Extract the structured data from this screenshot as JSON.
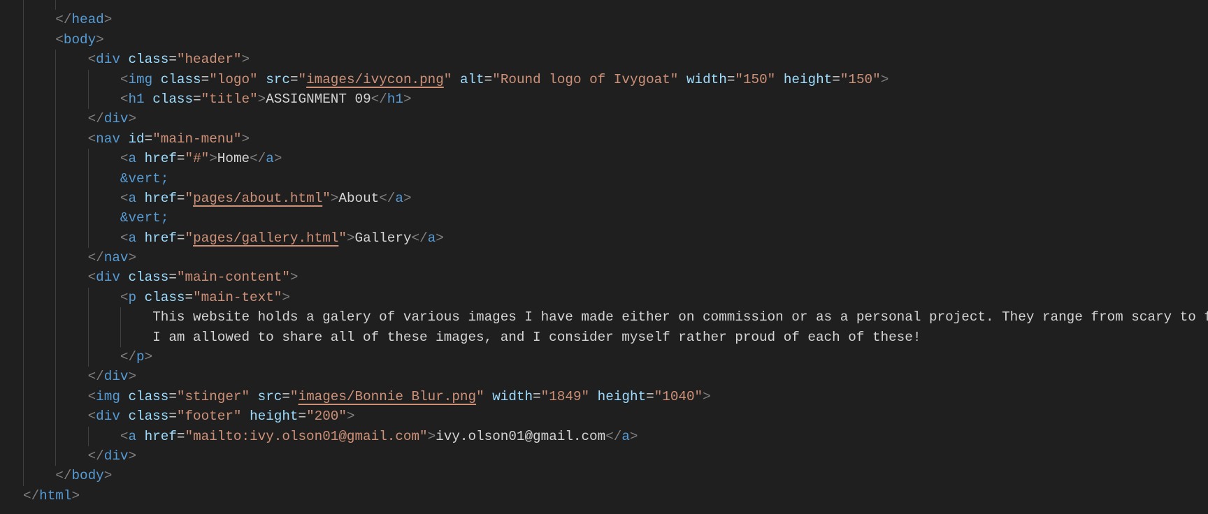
{
  "editor": {
    "colors": {
      "background": "#1f1f1f",
      "punctuation": "#808080",
      "tag": "#569cd6",
      "attribute": "#9cdcfe",
      "string": "#ce9178",
      "text": "#d4d4d4",
      "entity": "#569cd6"
    },
    "lines": [
      {
        "indent": 2,
        "tokens": []
      },
      {
        "indent": 1,
        "tokens": [
          [
            "p",
            "</"
          ],
          [
            "t",
            "head"
          ],
          [
            "p",
            ">"
          ]
        ]
      },
      {
        "indent": 1,
        "tokens": [
          [
            "p",
            "<"
          ],
          [
            "t",
            "body"
          ],
          [
            "p",
            ">"
          ]
        ]
      },
      {
        "indent": 2,
        "tokens": [
          [
            "p",
            "<"
          ],
          [
            "t",
            "div"
          ],
          [
            "x",
            " "
          ],
          [
            "a",
            "class"
          ],
          [
            "x",
            "="
          ],
          [
            "s",
            "\"header\""
          ],
          [
            "p",
            ">"
          ]
        ]
      },
      {
        "indent": 3,
        "tokens": [
          [
            "p",
            "<"
          ],
          [
            "t",
            "img"
          ],
          [
            "x",
            " "
          ],
          [
            "a",
            "class"
          ],
          [
            "x",
            "="
          ],
          [
            "s",
            "\"logo\""
          ],
          [
            "x",
            " "
          ],
          [
            "a",
            "src"
          ],
          [
            "x",
            "="
          ],
          [
            "s",
            "\""
          ],
          [
            "l",
            "images/ivycon.png"
          ],
          [
            "s",
            "\""
          ],
          [
            "x",
            " "
          ],
          [
            "a",
            "alt"
          ],
          [
            "x",
            "="
          ],
          [
            "s",
            "\"Round logo of Ivygoat\""
          ],
          [
            "x",
            " "
          ],
          [
            "a",
            "width"
          ],
          [
            "x",
            "="
          ],
          [
            "s",
            "\"150\""
          ],
          [
            "x",
            " "
          ],
          [
            "a",
            "height"
          ],
          [
            "x",
            "="
          ],
          [
            "s",
            "\"150\""
          ],
          [
            "p",
            ">"
          ]
        ]
      },
      {
        "indent": 3,
        "tokens": [
          [
            "p",
            "<"
          ],
          [
            "t",
            "h1"
          ],
          [
            "x",
            " "
          ],
          [
            "a",
            "class"
          ],
          [
            "x",
            "="
          ],
          [
            "s",
            "\"title\""
          ],
          [
            "p",
            ">"
          ],
          [
            "x",
            "ASSIGNMENT 09"
          ],
          [
            "p",
            "</"
          ],
          [
            "t",
            "h1"
          ],
          [
            "p",
            ">"
          ]
        ]
      },
      {
        "indent": 2,
        "tokens": [
          [
            "p",
            "</"
          ],
          [
            "t",
            "div"
          ],
          [
            "p",
            ">"
          ]
        ]
      },
      {
        "indent": 2,
        "tokens": [
          [
            "p",
            "<"
          ],
          [
            "t",
            "nav"
          ],
          [
            "x",
            " "
          ],
          [
            "a",
            "id"
          ],
          [
            "x",
            "="
          ],
          [
            "s",
            "\"main-menu\""
          ],
          [
            "p",
            ">"
          ]
        ]
      },
      {
        "indent": 3,
        "tokens": [
          [
            "p",
            "<"
          ],
          [
            "t",
            "a"
          ],
          [
            "x",
            " "
          ],
          [
            "a",
            "href"
          ],
          [
            "x",
            "="
          ],
          [
            "s",
            "\"#\""
          ],
          [
            "p",
            ">"
          ],
          [
            "x",
            "Home"
          ],
          [
            "p",
            "</"
          ],
          [
            "t",
            "a"
          ],
          [
            "p",
            ">"
          ]
        ]
      },
      {
        "indent": 3,
        "tokens": [
          [
            "e",
            "&vert;"
          ]
        ]
      },
      {
        "indent": 3,
        "tokens": [
          [
            "p",
            "<"
          ],
          [
            "t",
            "a"
          ],
          [
            "x",
            " "
          ],
          [
            "a",
            "href"
          ],
          [
            "x",
            "="
          ],
          [
            "s",
            "\""
          ],
          [
            "l",
            "pages/about.html"
          ],
          [
            "s",
            "\""
          ],
          [
            "p",
            ">"
          ],
          [
            "x",
            "About"
          ],
          [
            "p",
            "</"
          ],
          [
            "t",
            "a"
          ],
          [
            "p",
            ">"
          ]
        ]
      },
      {
        "indent": 3,
        "tokens": [
          [
            "e",
            "&vert;"
          ]
        ]
      },
      {
        "indent": 3,
        "tokens": [
          [
            "p",
            "<"
          ],
          [
            "t",
            "a"
          ],
          [
            "x",
            " "
          ],
          [
            "a",
            "href"
          ],
          [
            "x",
            "="
          ],
          [
            "s",
            "\""
          ],
          [
            "l",
            "pages/gallery.html"
          ],
          [
            "s",
            "\""
          ],
          [
            "p",
            ">"
          ],
          [
            "x",
            "Gallery"
          ],
          [
            "p",
            "</"
          ],
          [
            "t",
            "a"
          ],
          [
            "p",
            ">"
          ]
        ]
      },
      {
        "indent": 2,
        "tokens": [
          [
            "p",
            "</"
          ],
          [
            "t",
            "nav"
          ],
          [
            "p",
            ">"
          ]
        ]
      },
      {
        "indent": 2,
        "tokens": [
          [
            "p",
            "<"
          ],
          [
            "t",
            "div"
          ],
          [
            "x",
            " "
          ],
          [
            "a",
            "class"
          ],
          [
            "x",
            "="
          ],
          [
            "s",
            "\"main-content\""
          ],
          [
            "p",
            ">"
          ]
        ]
      },
      {
        "indent": 3,
        "tokens": [
          [
            "p",
            "<"
          ],
          [
            "t",
            "p"
          ],
          [
            "x",
            " "
          ],
          [
            "a",
            "class"
          ],
          [
            "x",
            "="
          ],
          [
            "s",
            "\"main-text\""
          ],
          [
            "p",
            ">"
          ]
        ]
      },
      {
        "indent": 4,
        "tokens": [
          [
            "x",
            "This website holds a galery of various images I have made either on commission or as a personal project. They range from scary to f"
          ]
        ]
      },
      {
        "indent": 4,
        "tokens": [
          [
            "x",
            "I am allowed to share all of these images, and I consider myself rather proud of each of these!"
          ]
        ]
      },
      {
        "indent": 3,
        "tokens": [
          [
            "p",
            "</"
          ],
          [
            "t",
            "p"
          ],
          [
            "p",
            ">"
          ]
        ]
      },
      {
        "indent": 2,
        "tokens": [
          [
            "p",
            "</"
          ],
          [
            "t",
            "div"
          ],
          [
            "p",
            ">"
          ]
        ]
      },
      {
        "indent": 2,
        "tokens": [
          [
            "p",
            "<"
          ],
          [
            "t",
            "img"
          ],
          [
            "x",
            " "
          ],
          [
            "a",
            "class"
          ],
          [
            "x",
            "="
          ],
          [
            "s",
            "\"stinger\""
          ],
          [
            "x",
            " "
          ],
          [
            "a",
            "src"
          ],
          [
            "x",
            "="
          ],
          [
            "s",
            "\""
          ],
          [
            "l",
            "images/Bonnie Blur.png"
          ],
          [
            "s",
            "\""
          ],
          [
            "x",
            " "
          ],
          [
            "a",
            "width"
          ],
          [
            "x",
            "="
          ],
          [
            "s",
            "\"1849\""
          ],
          [
            "x",
            " "
          ],
          [
            "a",
            "height"
          ],
          [
            "x",
            "="
          ],
          [
            "s",
            "\"1040\""
          ],
          [
            "p",
            ">"
          ]
        ]
      },
      {
        "indent": 2,
        "tokens": [
          [
            "p",
            "<"
          ],
          [
            "t",
            "div"
          ],
          [
            "x",
            " "
          ],
          [
            "a",
            "class"
          ],
          [
            "x",
            "="
          ],
          [
            "s",
            "\"footer\""
          ],
          [
            "x",
            " "
          ],
          [
            "a",
            "height"
          ],
          [
            "x",
            "="
          ],
          [
            "s",
            "\"200\""
          ],
          [
            "p",
            ">"
          ]
        ]
      },
      {
        "indent": 3,
        "tokens": [
          [
            "p",
            "<"
          ],
          [
            "t",
            "a"
          ],
          [
            "x",
            " "
          ],
          [
            "a",
            "href"
          ],
          [
            "x",
            "="
          ],
          [
            "s",
            "\"mailto:ivy.olson01@gmail.com\""
          ],
          [
            "p",
            ">"
          ],
          [
            "x",
            "ivy.olson01@gmail.com"
          ],
          [
            "p",
            "</"
          ],
          [
            "t",
            "a"
          ],
          [
            "p",
            ">"
          ]
        ]
      },
      {
        "indent": 2,
        "tokens": [
          [
            "p",
            "</"
          ],
          [
            "t",
            "div"
          ],
          [
            "p",
            ">"
          ]
        ]
      },
      {
        "indent": 1,
        "tokens": [
          [
            "p",
            "</"
          ],
          [
            "t",
            "body"
          ],
          [
            "p",
            ">"
          ]
        ]
      },
      {
        "indent": 0,
        "tokens": [
          [
            "p",
            "</"
          ],
          [
            "t",
            "html"
          ],
          [
            "p",
            ">"
          ]
        ]
      }
    ]
  }
}
